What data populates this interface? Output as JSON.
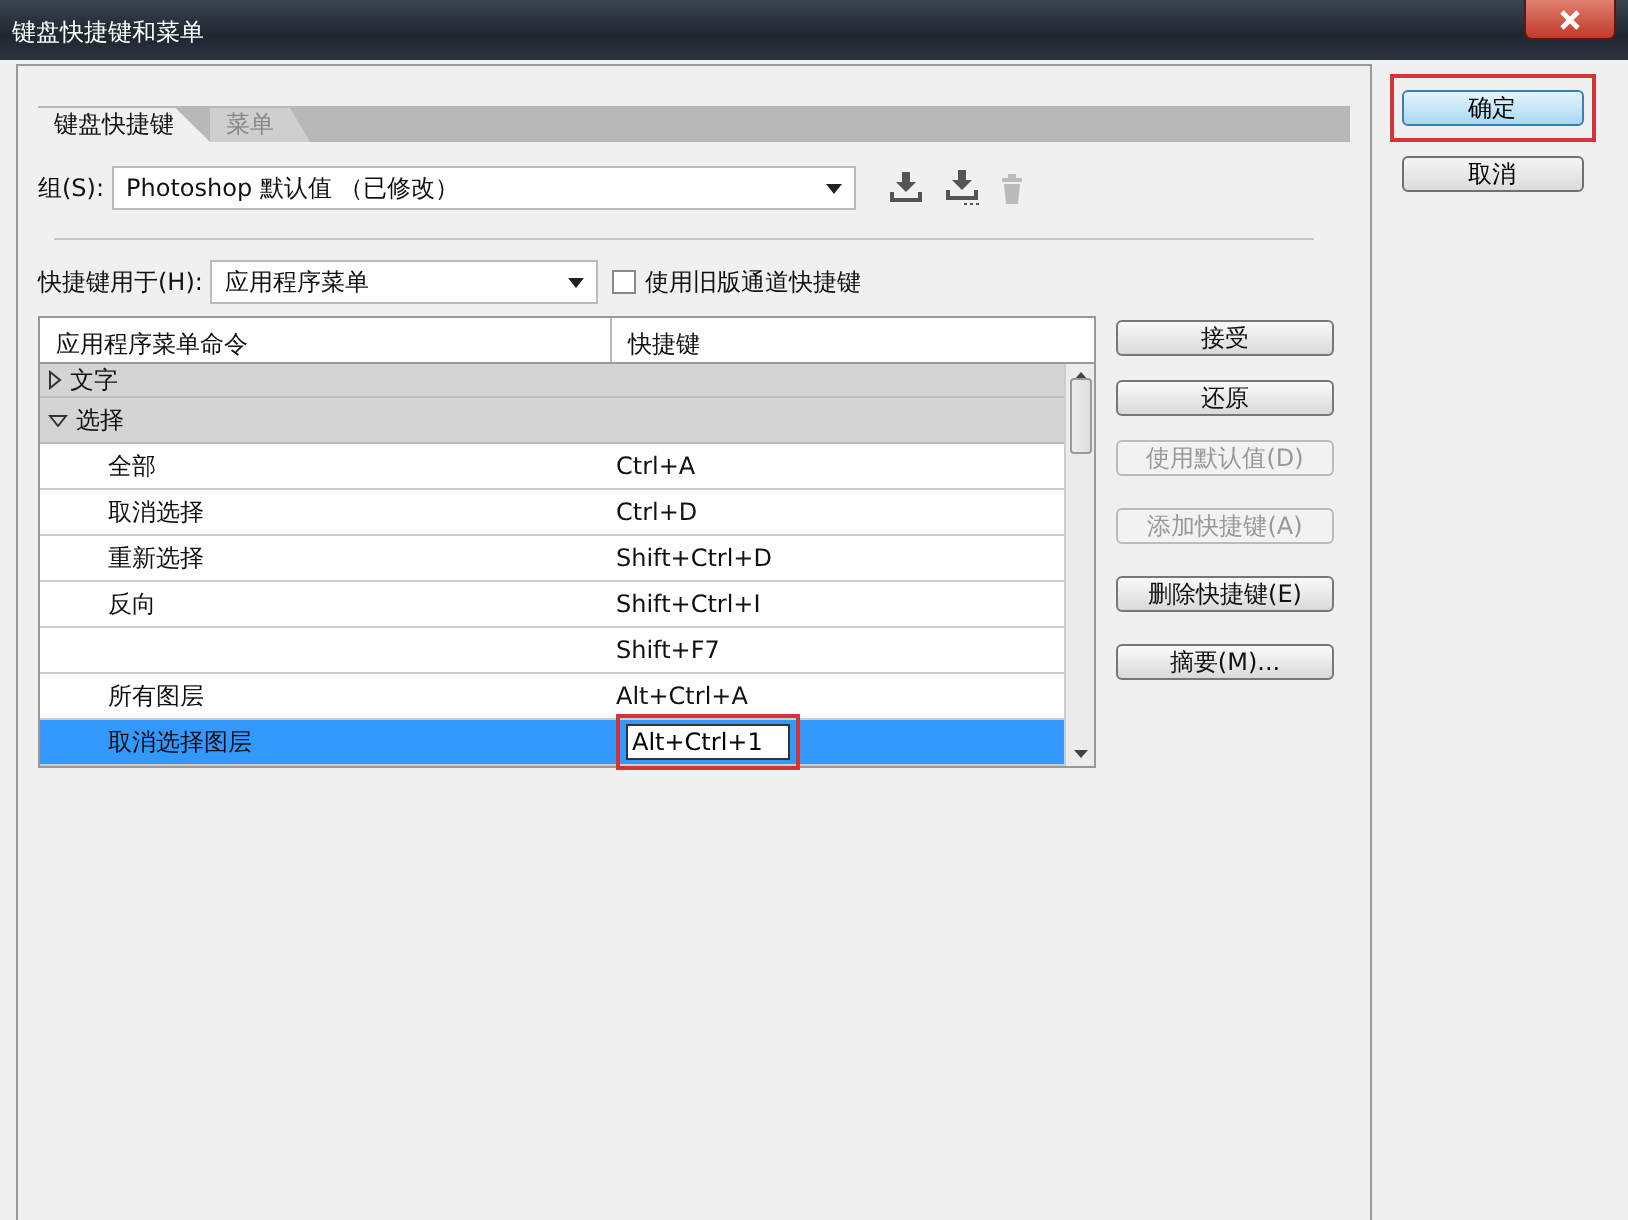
{
  "window": {
    "title": "键盘快捷键和菜单"
  },
  "tabs": [
    {
      "label": "键盘快捷键",
      "selected": true
    },
    {
      "label": "菜单",
      "selected": false
    }
  ],
  "group": {
    "label": "组(S):",
    "value": "Photoshop 默认值 （已修改）"
  },
  "shortcuts_for": {
    "label": "快捷键用于(H):",
    "value": "应用程序菜单"
  },
  "legacy_checkbox": {
    "label": "使用旧版通道快捷键",
    "checked": false
  },
  "table": {
    "columns": [
      "应用程序菜单命令",
      "快捷键"
    ],
    "rows": [
      {
        "kind": "group",
        "command": "文字",
        "expanded": false,
        "selected": false
      },
      {
        "kind": "group",
        "command": "选择",
        "expanded": true,
        "selected": false
      },
      {
        "kind": "item",
        "command": "全部",
        "shortcut": "Ctrl+A",
        "selected": false
      },
      {
        "kind": "item",
        "command": "取消选择",
        "shortcut": "Ctrl+D",
        "selected": false
      },
      {
        "kind": "item",
        "command": "重新选择",
        "shortcut": "Shift+Ctrl+D",
        "selected": false
      },
      {
        "kind": "item",
        "command": "反向",
        "shortcut": "Shift+Ctrl+I",
        "selected": false
      },
      {
        "kind": "item",
        "shortcut": "Shift+F7",
        "selected": false
      },
      {
        "kind": "item",
        "command": "所有图层",
        "shortcut": "Alt+Ctrl+A",
        "selected": false
      },
      {
        "kind": "item",
        "command": "取消选择图层",
        "shortcut": "Alt+Ctrl+1",
        "selected": true
      }
    ],
    "editor_highlighted": true
  },
  "side_buttons": [
    {
      "label": "接受",
      "disabled": false
    },
    {
      "label": "还原",
      "disabled": false
    },
    {
      "label": "使用默认值(D)",
      "disabled": true
    },
    {
      "label": "添加快捷键(A)",
      "disabled": true
    },
    {
      "label": "删除快捷键(E)",
      "disabled": false
    },
    {
      "label": "摘要(M)...",
      "disabled": false
    }
  ],
  "dialog_buttons": [
    {
      "label": "确定",
      "default": true,
      "highlighted": true
    },
    {
      "label": "取消",
      "default": false,
      "highlighted": false
    }
  ]
}
